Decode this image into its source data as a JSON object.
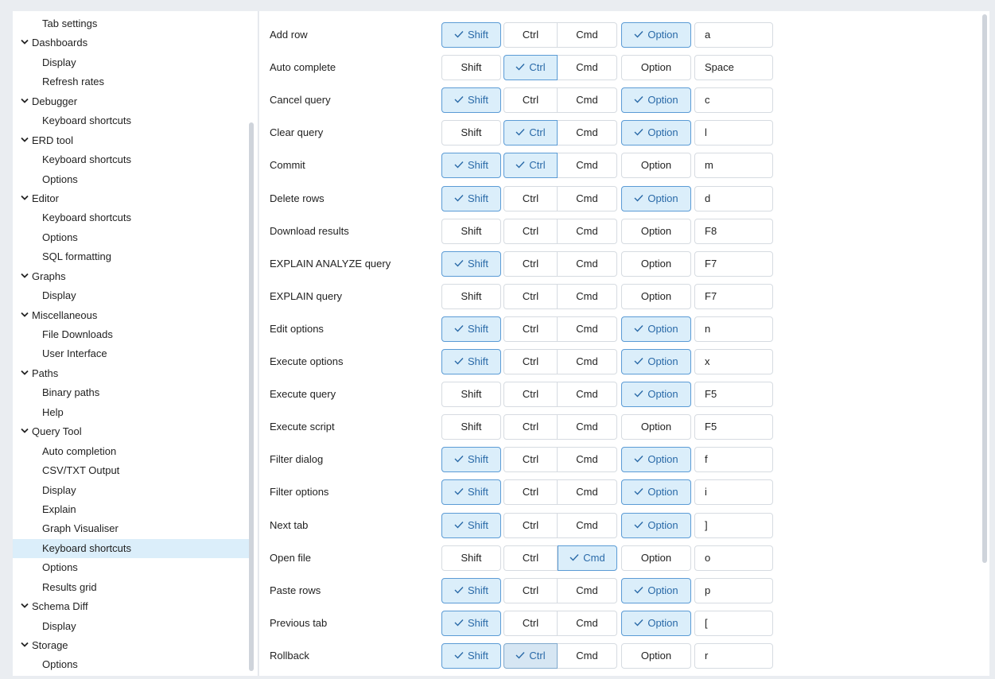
{
  "tree": {
    "items": [
      {
        "label": "Tab settings",
        "type": "child"
      },
      {
        "label": "Dashboards",
        "type": "group"
      },
      {
        "label": "Display",
        "type": "child"
      },
      {
        "label": "Refresh rates",
        "type": "child"
      },
      {
        "label": "Debugger",
        "type": "group"
      },
      {
        "label": "Keyboard shortcuts",
        "type": "child"
      },
      {
        "label": "ERD tool",
        "type": "group"
      },
      {
        "label": "Keyboard shortcuts",
        "type": "child"
      },
      {
        "label": "Options",
        "type": "child"
      },
      {
        "label": "Editor",
        "type": "group"
      },
      {
        "label": "Keyboard shortcuts",
        "type": "child"
      },
      {
        "label": "Options",
        "type": "child"
      },
      {
        "label": "SQL formatting",
        "type": "child"
      },
      {
        "label": "Graphs",
        "type": "group"
      },
      {
        "label": "Display",
        "type": "child"
      },
      {
        "label": "Miscellaneous",
        "type": "group"
      },
      {
        "label": "File Downloads",
        "type": "child"
      },
      {
        "label": "User Interface",
        "type": "child"
      },
      {
        "label": "Paths",
        "type": "group"
      },
      {
        "label": "Binary paths",
        "type": "child"
      },
      {
        "label": "Help",
        "type": "child"
      },
      {
        "label": "Query Tool",
        "type": "group"
      },
      {
        "label": "Auto completion",
        "type": "child"
      },
      {
        "label": "CSV/TXT Output",
        "type": "child"
      },
      {
        "label": "Display",
        "type": "child"
      },
      {
        "label": "Explain",
        "type": "child"
      },
      {
        "label": "Graph Visualiser",
        "type": "child"
      },
      {
        "label": "Keyboard shortcuts",
        "type": "child",
        "selected": true
      },
      {
        "label": "Options",
        "type": "child"
      },
      {
        "label": "Results grid",
        "type": "child"
      },
      {
        "label": "Schema Diff",
        "type": "group"
      },
      {
        "label": "Display",
        "type": "child"
      },
      {
        "label": "Storage",
        "type": "group"
      },
      {
        "label": "Options",
        "type": "child"
      }
    ]
  },
  "modifiers": {
    "shift": "Shift",
    "ctrl": "Ctrl",
    "cmd": "Cmd",
    "option": "Option"
  },
  "colors": {
    "accent": "#5b9bd5",
    "selected_bg": "#dbeefa",
    "panel_bg": "#eaedf1"
  },
  "shortcuts": [
    {
      "label": "Add row",
      "shift": true,
      "ctrl": false,
      "cmd": false,
      "option": true,
      "key": "a"
    },
    {
      "label": "Auto complete",
      "shift": false,
      "ctrl": true,
      "cmd": false,
      "option": false,
      "key": "Space"
    },
    {
      "label": "Cancel query",
      "shift": true,
      "ctrl": false,
      "cmd": false,
      "option": true,
      "key": "c"
    },
    {
      "label": "Clear query",
      "shift": false,
      "ctrl": true,
      "cmd": false,
      "option": true,
      "key": "l"
    },
    {
      "label": "Commit",
      "shift": true,
      "ctrl": true,
      "cmd": false,
      "option": false,
      "key": "m"
    },
    {
      "label": "Delete rows",
      "shift": true,
      "ctrl": false,
      "cmd": false,
      "option": true,
      "key": "d"
    },
    {
      "label": "Download results",
      "shift": false,
      "ctrl": false,
      "cmd": false,
      "option": false,
      "key": "F8"
    },
    {
      "label": "EXPLAIN ANALYZE query",
      "shift": true,
      "ctrl": false,
      "cmd": false,
      "option": false,
      "key": "F7"
    },
    {
      "label": "EXPLAIN query",
      "shift": false,
      "ctrl": false,
      "cmd": false,
      "option": false,
      "key": "F7"
    },
    {
      "label": "Edit options",
      "shift": true,
      "ctrl": false,
      "cmd": false,
      "option": true,
      "key": "n"
    },
    {
      "label": "Execute options",
      "shift": true,
      "ctrl": false,
      "cmd": false,
      "option": true,
      "key": "x"
    },
    {
      "label": "Execute query",
      "shift": false,
      "ctrl": false,
      "cmd": false,
      "option": true,
      "key": "F5"
    },
    {
      "label": "Execute script",
      "shift": false,
      "ctrl": false,
      "cmd": false,
      "option": false,
      "key": "F5"
    },
    {
      "label": "Filter dialog",
      "shift": true,
      "ctrl": false,
      "cmd": false,
      "option": true,
      "key": "f"
    },
    {
      "label": "Filter options",
      "shift": true,
      "ctrl": false,
      "cmd": false,
      "option": true,
      "key": "i"
    },
    {
      "label": "Next tab",
      "shift": true,
      "ctrl": false,
      "cmd": false,
      "option": true,
      "key": "]"
    },
    {
      "label": "Open file",
      "shift": false,
      "ctrl": false,
      "cmd": true,
      "option": false,
      "key": "o"
    },
    {
      "label": "Paste rows",
      "shift": true,
      "ctrl": false,
      "cmd": false,
      "option": true,
      "key": "p"
    },
    {
      "label": "Previous tab",
      "shift": true,
      "ctrl": false,
      "cmd": false,
      "option": true,
      "key": "["
    },
    {
      "label": "Rollback",
      "shift": true,
      "ctrl": true,
      "cmd": false,
      "option": false,
      "key": "r"
    }
  ]
}
